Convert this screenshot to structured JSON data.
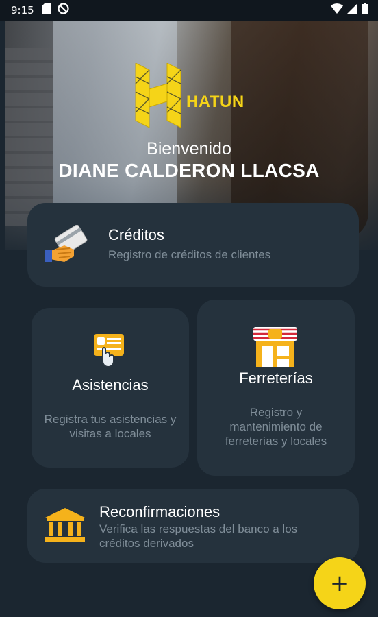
{
  "status_bar": {
    "time": "9:15",
    "icons": [
      "sd-card-icon",
      "do-not-disturb-icon",
      "wifi-icon",
      "signal-icon",
      "battery-icon"
    ]
  },
  "header": {
    "brand": "HATUN",
    "greeting": "Bienvenido",
    "user_name": "DIANE CALDERON LLACSA"
  },
  "menu": {
    "creditos": {
      "title": "Créditos",
      "subtitle": "Registro de créditos de clientes",
      "icon": "credit-card-hand-icon"
    },
    "asistencias": {
      "title": "Asistencias",
      "subtitle": "Registra tus asistencias y visitas a locales",
      "icon": "id-card-touch-icon"
    },
    "ferreterias": {
      "title": "Ferreterías",
      "subtitle": "Registro y mantenimiento de ferreterías y locales",
      "icon": "storefront-icon"
    },
    "reconfirmaciones": {
      "title": "Reconfirmaciones",
      "subtitle": "Verifica las respuestas del banco a los créditos derivados",
      "icon": "bank-icon"
    }
  },
  "fab": {
    "label": "+",
    "icon": "plus-icon"
  },
  "colors": {
    "accent": "#f5d418",
    "background": "#1b2630",
    "card": "#25323d",
    "muted_text": "#7f8d98"
  }
}
